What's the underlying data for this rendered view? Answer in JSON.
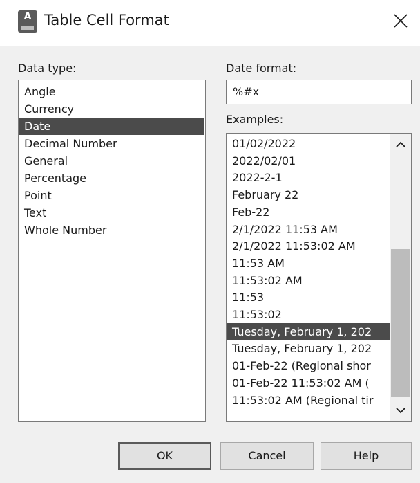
{
  "window": {
    "title": "Table Cell Format",
    "icon": "autocad-app-icon",
    "icon_letter": "A"
  },
  "data_type": {
    "label": "Data type:",
    "items": [
      "Angle",
      "Currency",
      "Date",
      "Decimal Number",
      "General",
      "Percentage",
      "Point",
      "Text",
      "Whole Number"
    ],
    "selected": "Date"
  },
  "date_format": {
    "label": "Date format:",
    "value": "%#x"
  },
  "examples": {
    "label": "Examples:",
    "items": [
      "01/02/2022",
      "2022/02/01",
      "2022-2-1",
      "February 22",
      "Feb-22",
      "2/1/2022 11:53 AM",
      "2/1/2022 11:53:02 AM",
      "11:53 AM",
      "11:53:02 AM",
      "11:53",
      "11:53:02",
      "Tuesday, February 1, 202",
      "Tuesday, February 1, 202",
      "01-Feb-22 (Regional shor",
      "01-Feb-22 11:53:02 AM (",
      "11:53:02 AM (Regional tir"
    ],
    "selected_index": 11
  },
  "buttons": {
    "ok": "OK",
    "cancel": "Cancel",
    "help": "Help"
  },
  "colors": {
    "selection": "#4b4b4b",
    "dialog_bg": "#f0f0f0"
  }
}
